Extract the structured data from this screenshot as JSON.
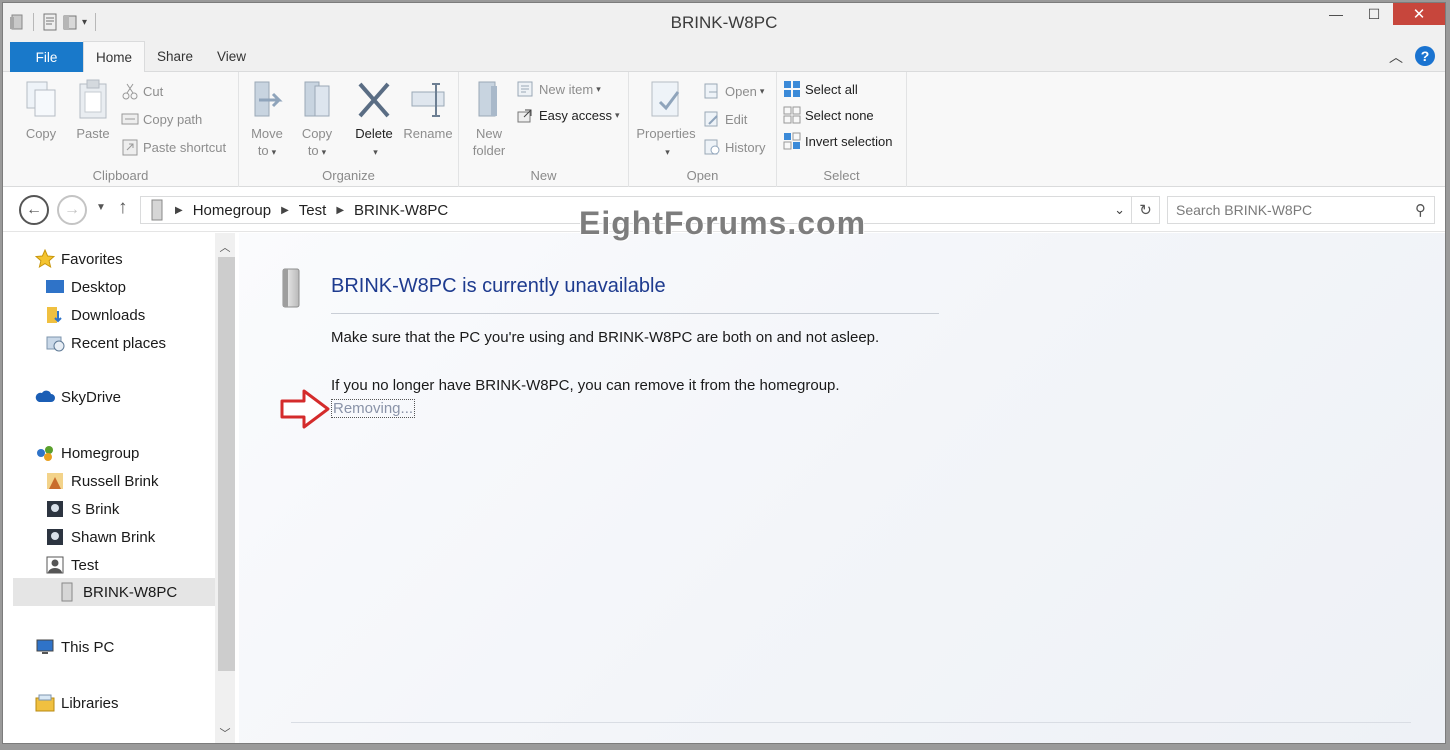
{
  "window": {
    "title": "BRINK-W8PC"
  },
  "controls": {
    "minimize": "—",
    "maximize": "☐",
    "close": "✕"
  },
  "tabs": {
    "file": "File",
    "home": "Home",
    "share": "Share",
    "view": "View"
  },
  "ribbon": {
    "clipboard": {
      "label": "Clipboard",
      "copy": "Copy",
      "paste": "Paste",
      "cut": "Cut",
      "copy_path": "Copy path",
      "paste_shortcut": "Paste shortcut"
    },
    "organize": {
      "label": "Organize",
      "move_to_1": "Move",
      "move_to_2": "to",
      "copy_to_1": "Copy",
      "copy_to_2": "to",
      "delete": "Delete",
      "rename": "Rename"
    },
    "new": {
      "label": "New",
      "new_folder_1": "New",
      "new_folder_2": "folder",
      "new_item": "New item",
      "easy_access": "Easy access"
    },
    "open": {
      "label": "Open",
      "properties": "Properties",
      "open": "Open",
      "edit": "Edit",
      "history": "History"
    },
    "select": {
      "label": "Select",
      "select_all": "Select all",
      "select_none": "Select none",
      "invert_selection": "Invert selection"
    }
  },
  "address": {
    "crumbs": [
      "Homegroup",
      "Test",
      "BRINK-W8PC"
    ],
    "search_placeholder": "Search BRINK-W8PC"
  },
  "watermark": "EightForums.com",
  "nav": {
    "favorites": "Favorites",
    "desktop": "Desktop",
    "downloads": "Downloads",
    "recent_places": "Recent places",
    "skydrive": "SkyDrive",
    "homegroup": "Homegroup",
    "russell_brink": "Russell Brink",
    "s_brink": "S Brink",
    "shawn_brink": "Shawn Brink",
    "test": "Test",
    "brink_w8pc": "BRINK-W8PC",
    "this_pc": "This PC",
    "libraries": "Libraries"
  },
  "message": {
    "title": "BRINK-W8PC is currently unavailable",
    "line1": "Make sure that the PC you're using and BRINK-W8PC are both on and not asleep.",
    "line2": "If you no longer have BRINK-W8PC, you can remove it from the homegroup.",
    "link": "Removing..."
  },
  "colors": {
    "accent": "#1979ca",
    "title_blue": "#1e3b8f",
    "close_red": "#c7463c",
    "annotation_red": "#d42b2b"
  }
}
